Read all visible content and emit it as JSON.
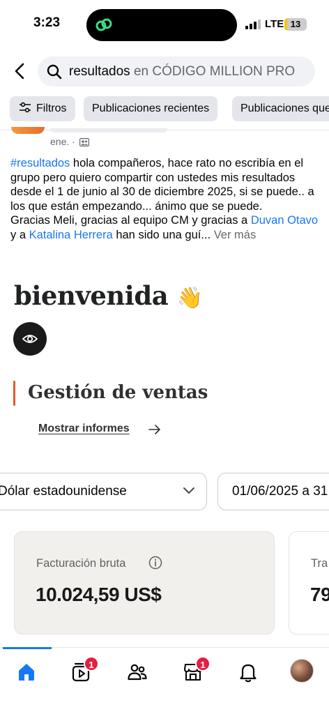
{
  "status_bar": {
    "time": "3:23",
    "network": "LTE",
    "battery": "13",
    "battery_level": 0.13
  },
  "search": {
    "query": "resultados",
    "scope": " en CÓDIGO MILLION PRO"
  },
  "filters": [
    {
      "label": "Filtros",
      "icon": "sliders-icon"
    },
    {
      "label": "Publicaciones recientes"
    },
    {
      "label": "Publicaciones que"
    }
  ],
  "post": {
    "meta": "ene. · ",
    "hashtag": "#resultados",
    "text_1": " hola compañeros, hace rato no escribía en el grupo pero quiero compartir con ustedes mis resultados desde el 1 de junio al 30 de diciembre 2025, si se puede.. a los que están empezando... ánimo que se puede.",
    "text_2": "Gracias Meli, gracias al equipo CM y gracias a ",
    "mention_1": "Duvan Otavo",
    "text_3": " y a ",
    "mention_2": "Katalina Herrera",
    "text_4": " han sido una guí... ",
    "see_more": "Ver más"
  },
  "shared_image": {
    "welcome": "bienvenida",
    "wave_emoji": "👋",
    "section_title": "Gestión de ventas",
    "show_reports": "Mostrar informes",
    "currency_select": "Dólar estadounidense",
    "date_range": "01/06/2025 a 31",
    "cards": [
      {
        "label": "Facturación bruta",
        "value": "10.024,59 US$"
      },
      {
        "label": "Tra",
        "value": "79"
      }
    ]
  },
  "nav": {
    "tabs": [
      {
        "name": "home",
        "badge": ""
      },
      {
        "name": "video",
        "badge": "1"
      },
      {
        "name": "groups",
        "badge": ""
      },
      {
        "name": "marketplace",
        "badge": "1"
      },
      {
        "name": "notifications",
        "badge": ""
      },
      {
        "name": "profile",
        "badge": ""
      }
    ]
  },
  "colors": {
    "accent": "#1877f2",
    "badge": "#e41e3f",
    "section_bar": "#e4582b"
  }
}
